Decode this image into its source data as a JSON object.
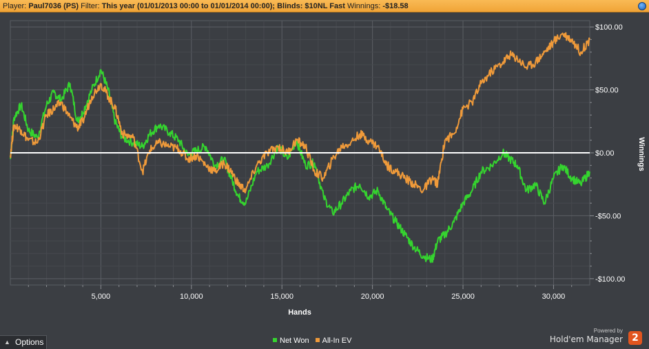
{
  "header": {
    "player_label": "Player:",
    "player_value": "Paul7036 (PS)",
    "filter_label": "Filter:",
    "filter_value": "This year (01/01/2013 00:00 to 01/01/2014 00:00); Blinds: $10NL Fast",
    "winnings_label": "Winnings:",
    "winnings_value": "-$18.58"
  },
  "footer": {
    "options_label": "Options",
    "powered_by": "Powered by",
    "brand_name": "Hold'em Manager",
    "brand_logo_text": "2"
  },
  "chart_data": {
    "type": "line",
    "xlabel": "Hands",
    "ylabel": "Winnings",
    "xlim": [
      0,
      32000
    ],
    "ylim": [
      -105,
      105
    ],
    "x_ticks": [
      5000,
      10000,
      15000,
      20000,
      25000,
      30000
    ],
    "x_tick_labels": [
      "5,000",
      "10,000",
      "15,000",
      "20,000",
      "25,000",
      "30,000"
    ],
    "y_ticks": [
      100,
      50,
      0,
      -50,
      -100
    ],
    "y_tick_labels": [
      "$100.00",
      "$50.00",
      "$0.00",
      "-$50.00",
      "-$100.00"
    ],
    "grid": true,
    "zero_line": true,
    "legend_position": "bottom",
    "series": [
      {
        "name": "Net Won",
        "color": "#35d42f",
        "x": [
          0,
          200,
          600,
          1000,
          1500,
          2000,
          2400,
          2800,
          3300,
          3700,
          4000,
          4500,
          5000,
          5400,
          5800,
          6200,
          6800,
          7300,
          7700,
          8200,
          8800,
          9300,
          9800,
          10300,
          10800,
          11300,
          11800,
          12200,
          12600,
          13000,
          13600,
          14200,
          14800,
          15300,
          15800,
          16300,
          16800,
          17300,
          17800,
          18300,
          18800,
          19300,
          19800,
          20300,
          20800,
          21300,
          21800,
          22300,
          22800,
          23300,
          23600,
          24000,
          24500,
          25000,
          25500,
          26000,
          26600,
          27200,
          27600,
          28000,
          28500,
          29000,
          29500,
          30000,
          30500,
          31000,
          31500,
          32000
        ],
        "y": [
          -5,
          28,
          38,
          18,
          12,
          38,
          48,
          42,
          55,
          25,
          32,
          50,
          66,
          50,
          24,
          12,
          8,
          5,
          15,
          22,
          16,
          10,
          -2,
          2,
          5,
          -10,
          -5,
          -20,
          -35,
          -40,
          -15,
          -10,
          5,
          -5,
          10,
          -10,
          -8,
          -35,
          -48,
          -40,
          -30,
          -25,
          -35,
          -30,
          -45,
          -55,
          -65,
          -75,
          -82,
          -85,
          -70,
          -65,
          -55,
          -40,
          -30,
          -15,
          -10,
          0,
          -5,
          -10,
          -30,
          -25,
          -40,
          -20,
          -10,
          -20,
          -25,
          -15
        ]
      },
      {
        "name": "All-In EV",
        "color": "#ef9a3a",
        "x": [
          0,
          200,
          600,
          1000,
          1500,
          2000,
          2400,
          2800,
          3300,
          3700,
          4000,
          4500,
          5000,
          5400,
          5800,
          6200,
          6800,
          7300,
          7700,
          8200,
          8800,
          9300,
          9800,
          10300,
          10800,
          11300,
          11800,
          12200,
          12600,
          13000,
          13600,
          14200,
          14800,
          15300,
          15800,
          16300,
          16800,
          17300,
          17800,
          18300,
          18800,
          19300,
          19800,
          20300,
          20800,
          21300,
          21800,
          22300,
          22800,
          23300,
          23600,
          24000,
          24500,
          25000,
          25500,
          26000,
          26600,
          27200,
          27600,
          28000,
          28500,
          29000,
          29500,
          30000,
          30500,
          31000,
          31500,
          32000
        ],
        "y": [
          -2,
          22,
          18,
          10,
          8,
          30,
          35,
          40,
          28,
          20,
          25,
          45,
          55,
          45,
          35,
          15,
          12,
          -15,
          2,
          8,
          5,
          3,
          -5,
          -2,
          -10,
          -15,
          -8,
          -15,
          -25,
          -30,
          -10,
          0,
          5,
          0,
          10,
          5,
          -15,
          -20,
          -5,
          5,
          8,
          15,
          10,
          5,
          -10,
          -15,
          -20,
          -25,
          -30,
          -20,
          -25,
          10,
          15,
          35,
          40,
          55,
          65,
          72,
          78,
          75,
          68,
          72,
          80,
          88,
          95,
          90,
          80,
          90
        ]
      }
    ]
  }
}
